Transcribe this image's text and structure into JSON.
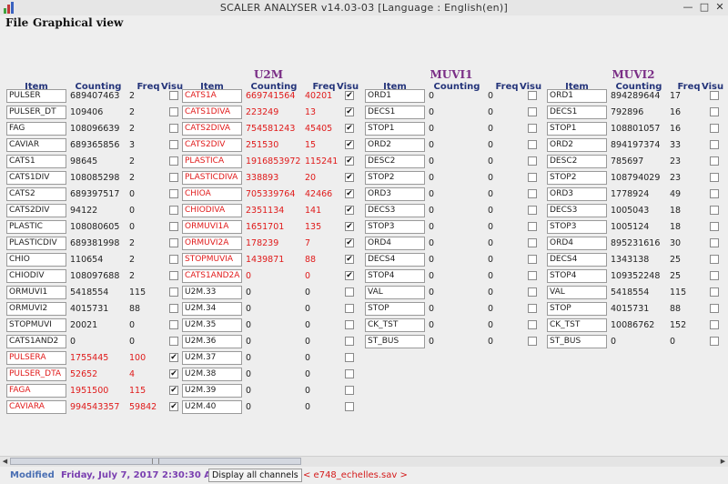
{
  "window": {
    "title": "SCALER ANALYSER v14.03-03 [Language : English(en)]"
  },
  "menu": [
    "File",
    "Graphical view"
  ],
  "headers": {
    "item": "Item",
    "counting": "Counting",
    "freq": "Freq",
    "visu": "Visu"
  },
  "groups": [
    {
      "title": "",
      "rows": [
        {
          "item": "PULSER",
          "count": "689407463",
          "freq": "2",
          "visu": false,
          "red": false
        },
        {
          "item": "PULSER_DT",
          "count": "109406",
          "freq": "2",
          "visu": false,
          "red": false
        },
        {
          "item": "FAG",
          "count": "108096639",
          "freq": "2",
          "visu": false,
          "red": false
        },
        {
          "item": "CAVIAR",
          "count": "689365856",
          "freq": "3",
          "visu": false,
          "red": false
        },
        {
          "item": "CATS1",
          "count": "98645",
          "freq": "2",
          "visu": false,
          "red": false
        },
        {
          "item": "CATS1DIV",
          "count": "108085298",
          "freq": "2",
          "visu": false,
          "red": false
        },
        {
          "item": "CATS2",
          "count": "689397517",
          "freq": "0",
          "visu": false,
          "red": false
        },
        {
          "item": "CATS2DIV",
          "count": "94122",
          "freq": "0",
          "visu": false,
          "red": false
        },
        {
          "item": "PLASTIC",
          "count": "108080605",
          "freq": "0",
          "visu": false,
          "red": false
        },
        {
          "item": "PLASTICDIV",
          "count": "689381998",
          "freq": "2",
          "visu": false,
          "red": false
        },
        {
          "item": "CHIO",
          "count": "110654",
          "freq": "2",
          "visu": false,
          "red": false
        },
        {
          "item": "CHIODIV",
          "count": "108097688",
          "freq": "2",
          "visu": false,
          "red": false
        },
        {
          "item": "ORMUVI1",
          "count": "5418554",
          "freq": "115",
          "visu": false,
          "red": false
        },
        {
          "item": "ORMUVI2",
          "count": "4015731",
          "freq": "88",
          "visu": false,
          "red": false
        },
        {
          "item": "STOPMUVI",
          "count": "20021",
          "freq": "0",
          "visu": false,
          "red": false
        },
        {
          "item": "CATS1AND2",
          "count": "0",
          "freq": "0",
          "visu": false,
          "red": false
        },
        {
          "item": "PULSERA",
          "count": "1755445",
          "freq": "100",
          "visu": true,
          "red": true
        },
        {
          "item": "PULSER_DTA",
          "count": "52652",
          "freq": "4",
          "visu": true,
          "red": true
        },
        {
          "item": "FAGA",
          "count": "1951500",
          "freq": "115",
          "visu": true,
          "red": true
        },
        {
          "item": "CAVIARA",
          "count": "994543357",
          "freq": "59842",
          "visu": true,
          "red": true
        }
      ]
    },
    {
      "title": "U2M",
      "rows": [
        {
          "item": "CATS1A",
          "count": "669741564",
          "freq": "40201",
          "visu": true,
          "red": true
        },
        {
          "item": "CATS1DIVA",
          "count": "223249",
          "freq": "13",
          "visu": true,
          "red": true
        },
        {
          "item": "CATS2DIVA",
          "count": "754581243",
          "freq": "45405",
          "visu": true,
          "red": true
        },
        {
          "item": "CATS2DIV",
          "count": "251530",
          "freq": "15",
          "visu": true,
          "red": true
        },
        {
          "item": "PLASTICA",
          "count": "1916853972",
          "freq": "115241",
          "visu": true,
          "red": true
        },
        {
          "item": "PLASTICDIVA",
          "count": "338893",
          "freq": "20",
          "visu": true,
          "red": true
        },
        {
          "item": "CHIOA",
          "count": "705339764",
          "freq": "42466",
          "visu": true,
          "red": true
        },
        {
          "item": "CHIODIVA",
          "count": "2351134",
          "freq": "141",
          "visu": true,
          "red": true
        },
        {
          "item": "ORMUVI1A",
          "count": "1651701",
          "freq": "135",
          "visu": true,
          "red": true
        },
        {
          "item": "ORMUVI2A",
          "count": "178239",
          "freq": "7",
          "visu": true,
          "red": true
        },
        {
          "item": "STOPMUVIA",
          "count": "1439871",
          "freq": "88",
          "visu": true,
          "red": true
        },
        {
          "item": "CATS1AND2A",
          "count": "0",
          "freq": "0",
          "visu": true,
          "red": true
        },
        {
          "item": "U2M.33",
          "count": "0",
          "freq": "0",
          "visu": false,
          "red": false
        },
        {
          "item": "U2M.34",
          "count": "0",
          "freq": "0",
          "visu": false,
          "red": false
        },
        {
          "item": "U2M.35",
          "count": "0",
          "freq": "0",
          "visu": false,
          "red": false
        },
        {
          "item": "U2M.36",
          "count": "0",
          "freq": "0",
          "visu": false,
          "red": false
        },
        {
          "item": "U2M.37",
          "count": "0",
          "freq": "0",
          "visu": false,
          "red": false
        },
        {
          "item": "U2M.38",
          "count": "0",
          "freq": "0",
          "visu": false,
          "red": false
        },
        {
          "item": "U2M.39",
          "count": "0",
          "freq": "0",
          "visu": false,
          "red": false
        },
        {
          "item": "U2M.40",
          "count": "0",
          "freq": "0",
          "visu": false,
          "red": false
        }
      ]
    },
    {
      "title": "MUVI1",
      "rows": [
        {
          "item": "ORD1",
          "count": "0",
          "freq": "0",
          "visu": false,
          "red": false
        },
        {
          "item": "DECS1",
          "count": "0",
          "freq": "0",
          "visu": false,
          "red": false
        },
        {
          "item": "STOP1",
          "count": "0",
          "freq": "0",
          "visu": false,
          "red": false
        },
        {
          "item": "ORD2",
          "count": "0",
          "freq": "0",
          "visu": false,
          "red": false
        },
        {
          "item": "DESC2",
          "count": "0",
          "freq": "0",
          "visu": false,
          "red": false
        },
        {
          "item": "STOP2",
          "count": "0",
          "freq": "0",
          "visu": false,
          "red": false
        },
        {
          "item": "ORD3",
          "count": "0",
          "freq": "0",
          "visu": false,
          "red": false
        },
        {
          "item": "DECS3",
          "count": "0",
          "freq": "0",
          "visu": false,
          "red": false
        },
        {
          "item": "STOP3",
          "count": "0",
          "freq": "0",
          "visu": false,
          "red": false
        },
        {
          "item": "ORD4",
          "count": "0",
          "freq": "0",
          "visu": false,
          "red": false
        },
        {
          "item": "DECS4",
          "count": "0",
          "freq": "0",
          "visu": false,
          "red": false
        },
        {
          "item": "STOP4",
          "count": "0",
          "freq": "0",
          "visu": false,
          "red": false
        },
        {
          "item": "VAL",
          "count": "0",
          "freq": "0",
          "visu": false,
          "red": false
        },
        {
          "item": "STOP",
          "count": "0",
          "freq": "0",
          "visu": false,
          "red": false
        },
        {
          "item": "CK_TST",
          "count": "0",
          "freq": "0",
          "visu": false,
          "red": false
        },
        {
          "item": "ST_BUS",
          "count": "0",
          "freq": "0",
          "visu": false,
          "red": false
        }
      ]
    },
    {
      "title": "MUVI2",
      "rows": [
        {
          "item": "ORD1",
          "count": "894289644",
          "freq": "17",
          "visu": false,
          "red": false
        },
        {
          "item": "DECS1",
          "count": "792896",
          "freq": "16",
          "visu": false,
          "red": false
        },
        {
          "item": "STOP1",
          "count": "108801057",
          "freq": "16",
          "visu": false,
          "red": false
        },
        {
          "item": "ORD2",
          "count": "894197374",
          "freq": "33",
          "visu": false,
          "red": false
        },
        {
          "item": "DESC2",
          "count": "785697",
          "freq": "23",
          "visu": false,
          "red": false
        },
        {
          "item": "STOP2",
          "count": "108794029",
          "freq": "23",
          "visu": false,
          "red": false
        },
        {
          "item": "ORD3",
          "count": "1778924",
          "freq": "49",
          "visu": false,
          "red": false
        },
        {
          "item": "DECS3",
          "count": "1005043",
          "freq": "18",
          "visu": false,
          "red": false
        },
        {
          "item": "STOP3",
          "count": "1005124",
          "freq": "18",
          "visu": false,
          "red": false
        },
        {
          "item": "ORD4",
          "count": "895231616",
          "freq": "30",
          "visu": false,
          "red": false
        },
        {
          "item": "DECS4",
          "count": "1343138",
          "freq": "25",
          "visu": false,
          "red": false
        },
        {
          "item": "STOP4",
          "count": "109352248",
          "freq": "25",
          "visu": false,
          "red": false
        },
        {
          "item": "VAL",
          "count": "5418554",
          "freq": "115",
          "visu": false,
          "red": false
        },
        {
          "item": "STOP",
          "count": "4015731",
          "freq": "88",
          "visu": false,
          "red": false
        },
        {
          "item": "CK_TST",
          "count": "10086762",
          "freq": "152",
          "visu": false,
          "red": false
        },
        {
          "item": "ST_BUS",
          "count": "0",
          "freq": "0",
          "visu": false,
          "red": false
        }
      ]
    }
  ],
  "status": {
    "modified": "Modified",
    "datetime": "Friday, July 7, 2017 2:30:30 AM",
    "display_all_button": "Display all channels",
    "file": "< e748_echelles.sav >"
  },
  "colors": {
    "group_title": "#7a2e86",
    "header": "#24347a",
    "alert": "#e01a1a"
  }
}
